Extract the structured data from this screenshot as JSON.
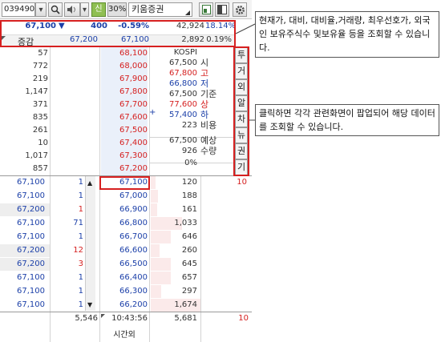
{
  "toolbar": {
    "code": "039490",
    "credit_badge": "신",
    "margin": "30%",
    "name": "키움증권"
  },
  "summary": {
    "price": "67,100",
    "arrow": "▼",
    "change": "400",
    "rate": "-0.59%",
    "volume": "42,924",
    "right_pct": "18.14%",
    "label": "증감",
    "ask_delta": "67,200",
    "bid_delta": "67,100",
    "vol2": "2,892",
    "pct2": "0.19%"
  },
  "asks": [
    {
      "qty": "57",
      "price": "68,100"
    },
    {
      "qty": "772",
      "price": "68,000"
    },
    {
      "qty": "219",
      "price": "67,900"
    },
    {
      "qty": "1,147",
      "price": "67,800"
    },
    {
      "qty": "371",
      "price": "67,700"
    },
    {
      "qty": "835",
      "price": "67,600"
    },
    {
      "qty": "261",
      "price": "67,500"
    },
    {
      "qty": "10",
      "price": "67,400"
    },
    {
      "qty": "1,017",
      "price": "67,300"
    },
    {
      "qty": "857",
      "price": "67,200"
    }
  ],
  "info": [
    {
      "value": "KOSPI",
      "label": ""
    },
    {
      "value": "67,500",
      "label": "시"
    },
    {
      "value": "67,800",
      "label": "고"
    },
    {
      "value": "66,800",
      "label": "저"
    },
    {
      "value": "67,500",
      "label": "기준"
    },
    {
      "value": "77,600",
      "label": "상"
    },
    {
      "value": "57,400",
      "label": "하"
    },
    {
      "value": "223",
      "label": "비용"
    },
    {
      "value": "67,500",
      "label": "예상"
    },
    {
      "value": "926",
      "label": "수량"
    },
    {
      "value": "0%",
      "label": ""
    }
  ],
  "trades": [
    {
      "price": "67,100",
      "qty": "1"
    },
    {
      "price": "67,100",
      "qty": "1"
    },
    {
      "price": "67,200",
      "qty": "1"
    },
    {
      "price": "67,100",
      "qty": "71"
    },
    {
      "price": "67,100",
      "qty": "1"
    },
    {
      "price": "67,200",
      "qty": "12"
    },
    {
      "price": "67,200",
      "qty": "3"
    },
    {
      "price": "67,100",
      "qty": "1"
    },
    {
      "price": "67,100",
      "qty": "1"
    },
    {
      "price": "67,100",
      "qty": "1"
    }
  ],
  "bids": [
    {
      "price": "67,100",
      "qty": "120",
      "extra": "10"
    },
    {
      "price": "67,000",
      "qty": "188",
      "extra": ""
    },
    {
      "price": "66,900",
      "qty": "161",
      "extra": ""
    },
    {
      "price": "66,800",
      "qty": "1,033",
      "extra": ""
    },
    {
      "price": "66,700",
      "qty": "646",
      "extra": ""
    },
    {
      "price": "66,600",
      "qty": "260",
      "extra": ""
    },
    {
      "price": "66,500",
      "qty": "645",
      "extra": ""
    },
    {
      "price": "66,400",
      "qty": "657",
      "extra": ""
    },
    {
      "price": "66,300",
      "qty": "297",
      "extra": ""
    },
    {
      "price": "66,200",
      "qty": "1,674",
      "extra": ""
    }
  ],
  "footer": {
    "ask_total": "5,546",
    "time": "10:43:56",
    "bid_total": "5,681",
    "extra": "10",
    "after_hours": "시간외"
  },
  "tabs": [
    "투",
    "거",
    "외",
    "알",
    "차",
    "뉴",
    "권",
    "기"
  ],
  "callouts": {
    "top": "현재가, 대비, 대비율,거래량, 최우선호가, 외국인 보유주식수 및보유율 등을 조회할 수 있습니다.",
    "mid": "클릭하면 각각 관련화면이 팝업되어 해당 데이터를 조회할 수 있습니다."
  }
}
